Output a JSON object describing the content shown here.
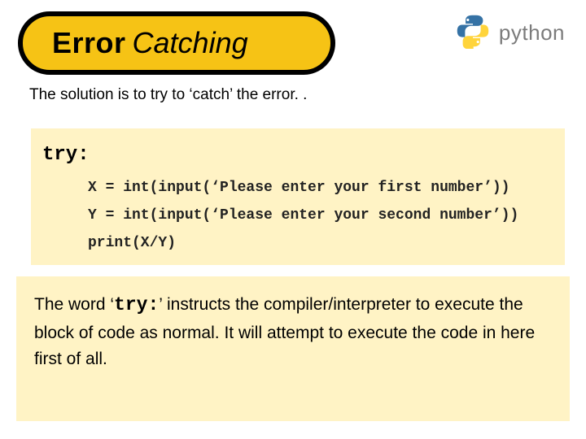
{
  "title": {
    "bold": "Error",
    "italic": "Catching"
  },
  "logo": {
    "word": "python",
    "icon_name": "python-logo-icon"
  },
  "intro": "The solution is to try to ‘catch’ the error. .",
  "code": {
    "try_kw": "try:",
    "line1": "X = int(input(‘Please enter your first number’))",
    "line2": "Y = int(input(‘Please enter your second number’))",
    "line3": "print(X/Y)"
  },
  "explain": {
    "pre": "The word ‘",
    "kw": "try:",
    "post": "’ instructs the compiler/interpreter to execute the block of code as normal.  It will attempt to execute the code in here first of all."
  }
}
